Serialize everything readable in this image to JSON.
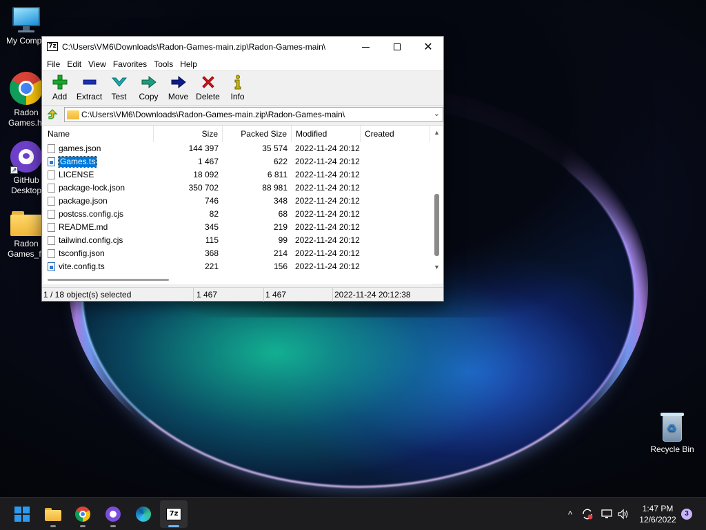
{
  "desktop": {
    "icons": [
      {
        "label": "My Compu",
        "icon": "computer-icon"
      },
      {
        "label": "Radon Games.ht",
        "icon": "chrome-icon"
      },
      {
        "label": "GitHub Desktop",
        "icon": "github-desktop-icon"
      },
      {
        "label": "Radon Games_fil",
        "icon": "folder-icon"
      },
      {
        "label": "Recycle Bin",
        "icon": "recycle-bin-icon"
      }
    ]
  },
  "window": {
    "app_icon": "7z",
    "title": "C:\\Users\\VM6\\Downloads\\Radon-Games-main.zip\\Radon-Games-main\\",
    "menu": [
      "File",
      "Edit",
      "View",
      "Favorites",
      "Tools",
      "Help"
    ],
    "toolbar": [
      {
        "label": "Add",
        "icon": "add-icon",
        "color": "#19a82b"
      },
      {
        "label": "Extract",
        "icon": "extract-icon",
        "color": "#1a2fb8"
      },
      {
        "label": "Test",
        "icon": "test-icon",
        "color": "#1ba9b0"
      },
      {
        "label": "Copy",
        "icon": "copy-icon",
        "color": "#1d9d7d"
      },
      {
        "label": "Move",
        "icon": "move-icon",
        "color": "#0c1c8e"
      },
      {
        "label": "Delete",
        "icon": "delete-icon",
        "color": "#d8161b"
      },
      {
        "label": "Info",
        "icon": "info-icon",
        "color": "#c8b800"
      }
    ],
    "address": "C:\\Users\\VM6\\Downloads\\Radon-Games-main.zip\\Radon-Games-main\\",
    "columns": [
      "Name",
      "Size",
      "Packed Size",
      "Modified",
      "Created"
    ],
    "files": [
      {
        "name": "games.json",
        "size": "144 397",
        "packed": "35 574",
        "modified": "2022-11-24 20:12",
        "created": "",
        "type": "file",
        "selected": false
      },
      {
        "name": "Games.ts",
        "size": "1 467",
        "packed": "622",
        "modified": "2022-11-24 20:12",
        "created": "",
        "type": "ts",
        "selected": true
      },
      {
        "name": "LICENSE",
        "size": "18 092",
        "packed": "6 811",
        "modified": "2022-11-24 20:12",
        "created": "",
        "type": "file",
        "selected": false
      },
      {
        "name": "package-lock.json",
        "size": "350 702",
        "packed": "88 981",
        "modified": "2022-11-24 20:12",
        "created": "",
        "type": "file",
        "selected": false
      },
      {
        "name": "package.json",
        "size": "746",
        "packed": "348",
        "modified": "2022-11-24 20:12",
        "created": "",
        "type": "file",
        "selected": false
      },
      {
        "name": "postcss.config.cjs",
        "size": "82",
        "packed": "68",
        "modified": "2022-11-24 20:12",
        "created": "",
        "type": "file",
        "selected": false
      },
      {
        "name": "README.md",
        "size": "345",
        "packed": "219",
        "modified": "2022-11-24 20:12",
        "created": "",
        "type": "file",
        "selected": false
      },
      {
        "name": "tailwind.config.cjs",
        "size": "115",
        "packed": "99",
        "modified": "2022-11-24 20:12",
        "created": "",
        "type": "file",
        "selected": false
      },
      {
        "name": "tsconfig.json",
        "size": "368",
        "packed": "214",
        "modified": "2022-11-24 20:12",
        "created": "",
        "type": "file",
        "selected": false
      },
      {
        "name": "vite.config.ts",
        "size": "221",
        "packed": "156",
        "modified": "2022-11-24 20:12",
        "created": "",
        "type": "ts",
        "selected": false
      }
    ],
    "vertical_scroll": {
      "thumb_start": 0.45,
      "thumb_end": 0.95
    },
    "horizontal_scroll": {
      "thumb_start": 0.0,
      "thumb_end": 0.32
    },
    "status": {
      "selection": "1 / 18 object(s) selected",
      "size": "1 467",
      "packed": "1 467",
      "modified": "2022-11-24 20:12:38"
    }
  },
  "taskbar": {
    "apps": [
      {
        "name": "start",
        "icon": "windows-logo-icon"
      },
      {
        "name": "file-explorer",
        "icon": "folder-icon"
      },
      {
        "name": "chrome",
        "icon": "chrome-icon"
      },
      {
        "name": "github-desktop",
        "icon": "github-desktop-icon"
      },
      {
        "name": "edge",
        "icon": "edge-icon"
      },
      {
        "name": "7-zip",
        "icon": "7zip-icon",
        "label": "7z"
      }
    ],
    "tray": {
      "chevron": "^",
      "time": "1:47 PM",
      "date": "12/6/2022",
      "notifications": "3"
    }
  }
}
